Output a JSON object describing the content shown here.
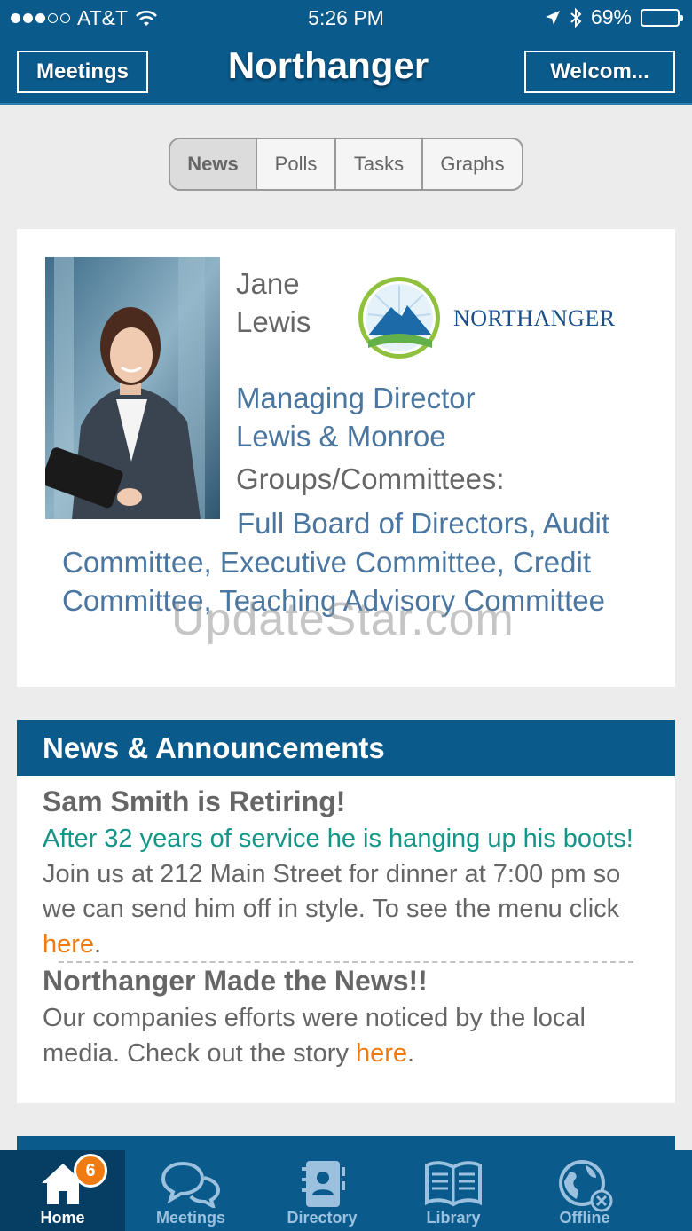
{
  "status_bar": {
    "carrier": "AT&T",
    "time": "5:26 PM",
    "battery": "69%",
    "signal_bars": 3,
    "battery_level": 0.69
  },
  "header": {
    "left_button": "Meetings",
    "title": "Northanger",
    "right_button": "Welcom..."
  },
  "segments": [
    {
      "label": "News",
      "active": true
    },
    {
      "label": "Polls",
      "active": false
    },
    {
      "label": "Tasks",
      "active": false
    },
    {
      "label": "Graphs",
      "active": false
    }
  ],
  "profile": {
    "first_name": "Jane",
    "last_name": "Lewis",
    "logo_text": "NORTHANGER",
    "position": "Managing Director",
    "company": "Lewis & Monroe",
    "groups_label": "Groups/Committees:",
    "groups": "Full Board of Directors, Audit Committee, Executive Committee, Credit Committee, Teaching Advisory Committee"
  },
  "watermark": "UpdateStar.com",
  "news": {
    "heading": "News & Announcements",
    "items": [
      {
        "title": "Sam Smith is Retiring!",
        "highlight": "After 32 years of service he is hanging up his boots!",
        "body": " Join us at 212 Main Street for dinner at 7:00 pm so we can send him off in style. To see the menu click ",
        "link": "here",
        "end": "."
      },
      {
        "title": "Northanger Made the News!!",
        "body": "Our companies efforts were noticed by the local media. Check out the story ",
        "link": "here",
        "end": "."
      }
    ]
  },
  "tabbar": {
    "badge": "6",
    "tabs": [
      {
        "label": "Home",
        "icon": "home-icon",
        "active": true
      },
      {
        "label": "Meetings",
        "icon": "chat-bubbles-icon",
        "active": false
      },
      {
        "label": "Directory",
        "icon": "contact-book-icon",
        "active": false
      },
      {
        "label": "Library",
        "icon": "open-book-icon",
        "active": false
      },
      {
        "label": "Offline",
        "icon": "globe-offline-icon",
        "active": false
      }
    ]
  },
  "colors": {
    "brand_blue": "#0a5a8c",
    "link_orange": "#ef7b10",
    "teal": "#139588",
    "profile_blue": "#4a76a0"
  }
}
